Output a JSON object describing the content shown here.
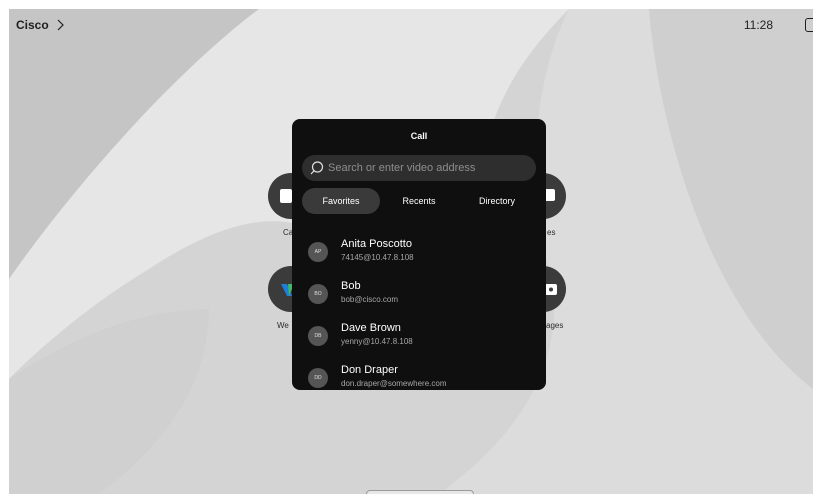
{
  "topbar": {
    "brand": "Cisco",
    "time": "11:28"
  },
  "home_tiles": [
    {
      "label": "Ca",
      "icon": "call-icon"
    },
    {
      "label": "es",
      "icon": "messages-icon"
    },
    {
      "label": "We",
      "icon": "webex-icon"
    },
    {
      "label": "ages",
      "icon": "whiteboard-icon"
    }
  ],
  "call_panel": {
    "title": "Call",
    "search": {
      "placeholder": "Search or enter video address",
      "value": ""
    },
    "tabs": [
      {
        "label": "Favorites",
        "active": true
      },
      {
        "label": "Recents",
        "active": false
      },
      {
        "label": "Directory",
        "active": false
      }
    ],
    "contacts": [
      {
        "initials": "AP",
        "name": "Anita Poscotto",
        "address": "74145@10.47.8.108"
      },
      {
        "initials": "BO",
        "name": "Bob",
        "address": "bob@cisco.com"
      },
      {
        "initials": "DB",
        "name": "Dave Brown",
        "address": "yenny@10.47.8.108"
      },
      {
        "initials": "DD",
        "name": "Don Draper",
        "address": "don.draper@somewhere.com"
      }
    ]
  },
  "colors": {
    "panel_bg": "#0f0f0f",
    "search_bg": "#2e2e2e",
    "active_tab_bg": "#3a3a3a",
    "avatar_bg": "#555555",
    "webex_accent": "#1f7fd6"
  }
}
